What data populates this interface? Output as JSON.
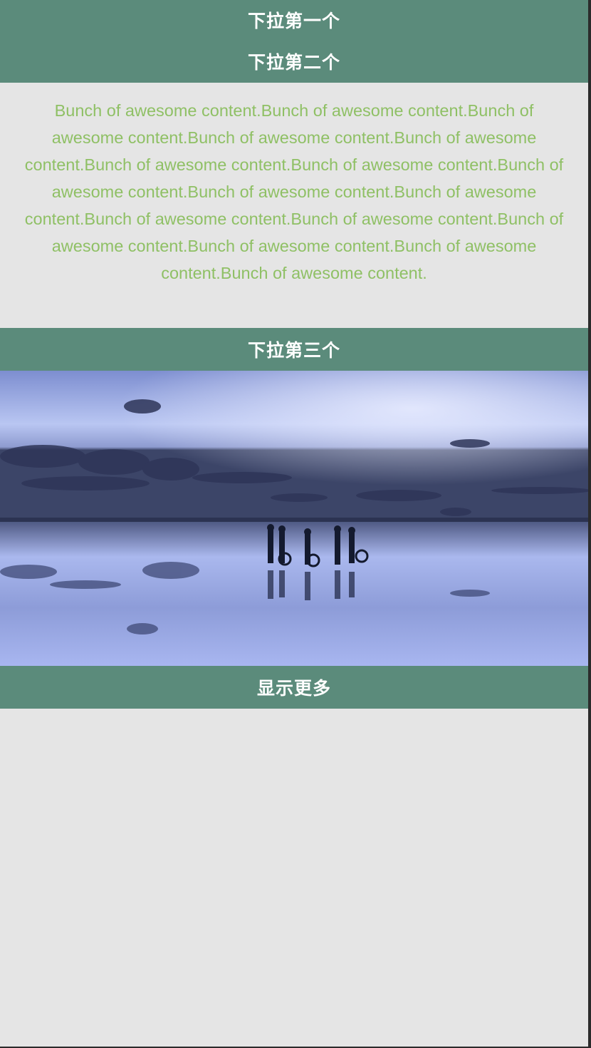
{
  "accordion": {
    "item1_title": "下拉第一个",
    "item2_title": "下拉第二个",
    "item2_content": "Bunch of awesome content.Bunch of awesome content.Bunch of awesome content.Bunch of awesome content.Bunch of awesome content.Bunch of awesome content.Bunch of awesome content.Bunch of awesome content.Bunch of awesome content.Bunch of awesome content.Bunch of awesome content.Bunch of awesome content.Bunch of awesome content.Bunch of awesome content.Bunch of awesome content.Bunch of awesome content.",
    "item3_title": "下拉第三个",
    "show_more_label": "显示更多"
  },
  "colors": {
    "header_bg": "#5b8b7b",
    "header_text": "#ffffff",
    "content_text": "#8fc065",
    "page_bg": "#e5e5e5"
  }
}
